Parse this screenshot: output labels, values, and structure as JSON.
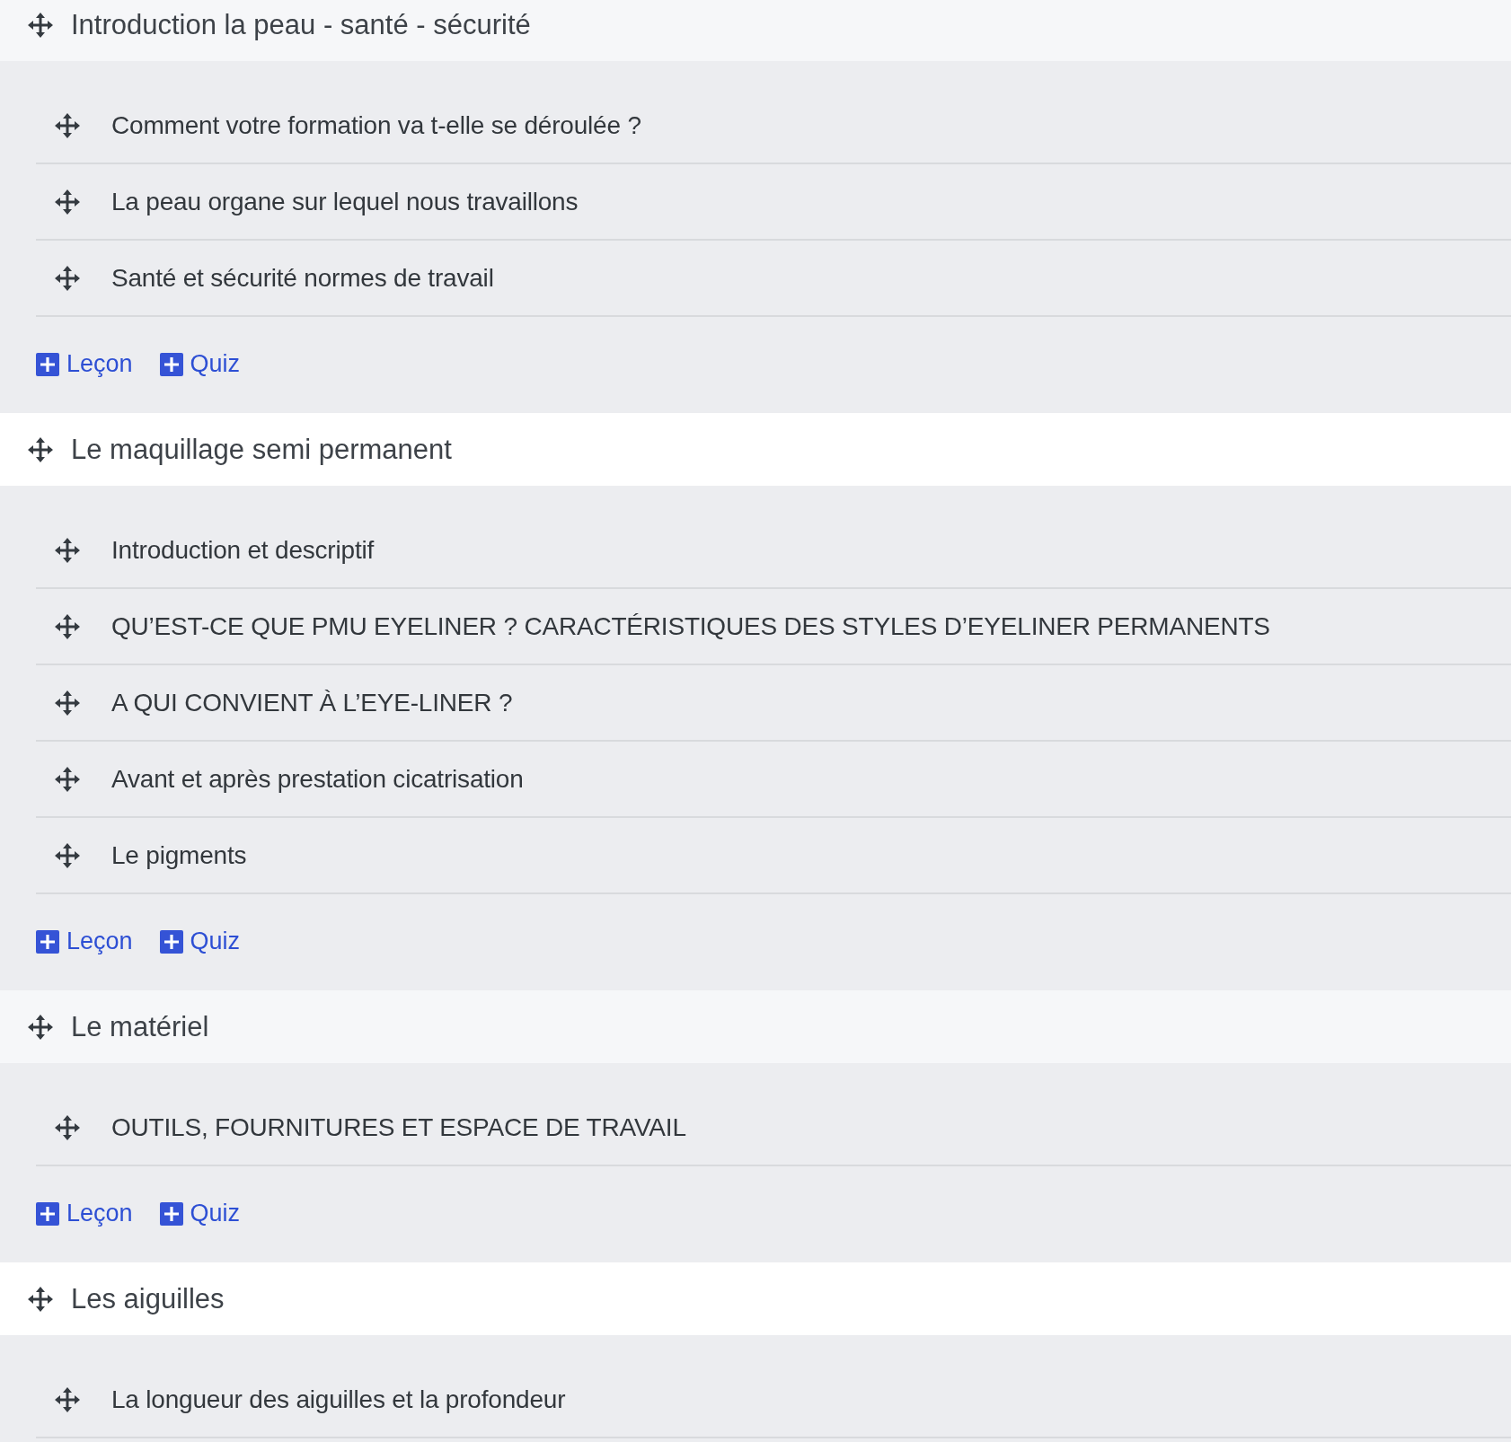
{
  "sections": [
    {
      "title": "Introduction la peau - santé - sécurité",
      "lessons": [
        {
          "title": "Comment votre formation va t-elle se déroulée ?"
        },
        {
          "title": "La peau organe sur lequel nous travaillons"
        },
        {
          "title": "Santé et sécurité normes de travail"
        }
      ],
      "actions": [
        {
          "label": "Leçon"
        },
        {
          "label": "Quiz"
        }
      ]
    },
    {
      "title": "Le maquillage semi permanent",
      "lessons": [
        {
          "title": "Introduction et descriptif"
        },
        {
          "title": "QU’EST-CE QUE PMU EYELINER ? CARACTÉRISTIQUES DES STYLES D’EYELINER PERMANENTS"
        },
        {
          "title": "A QUI CONVIENT À L’EYE-LINER ?"
        },
        {
          "title": "Avant et après prestation cicatrisation"
        },
        {
          "title": "Le pigments"
        }
      ],
      "actions": [
        {
          "label": "Leçon"
        },
        {
          "label": "Quiz"
        }
      ]
    },
    {
      "title": "Le matériel",
      "lessons": [
        {
          "title": "OUTILS, FOURNITURES ET ESPACE DE TRAVAIL"
        }
      ],
      "actions": [
        {
          "label": "Leçon"
        },
        {
          "label": "Quiz"
        }
      ]
    },
    {
      "title": "Les aiguilles",
      "lessons": [
        {
          "title": "La longueur des aiguilles et la profondeur"
        }
      ]
    }
  ]
}
